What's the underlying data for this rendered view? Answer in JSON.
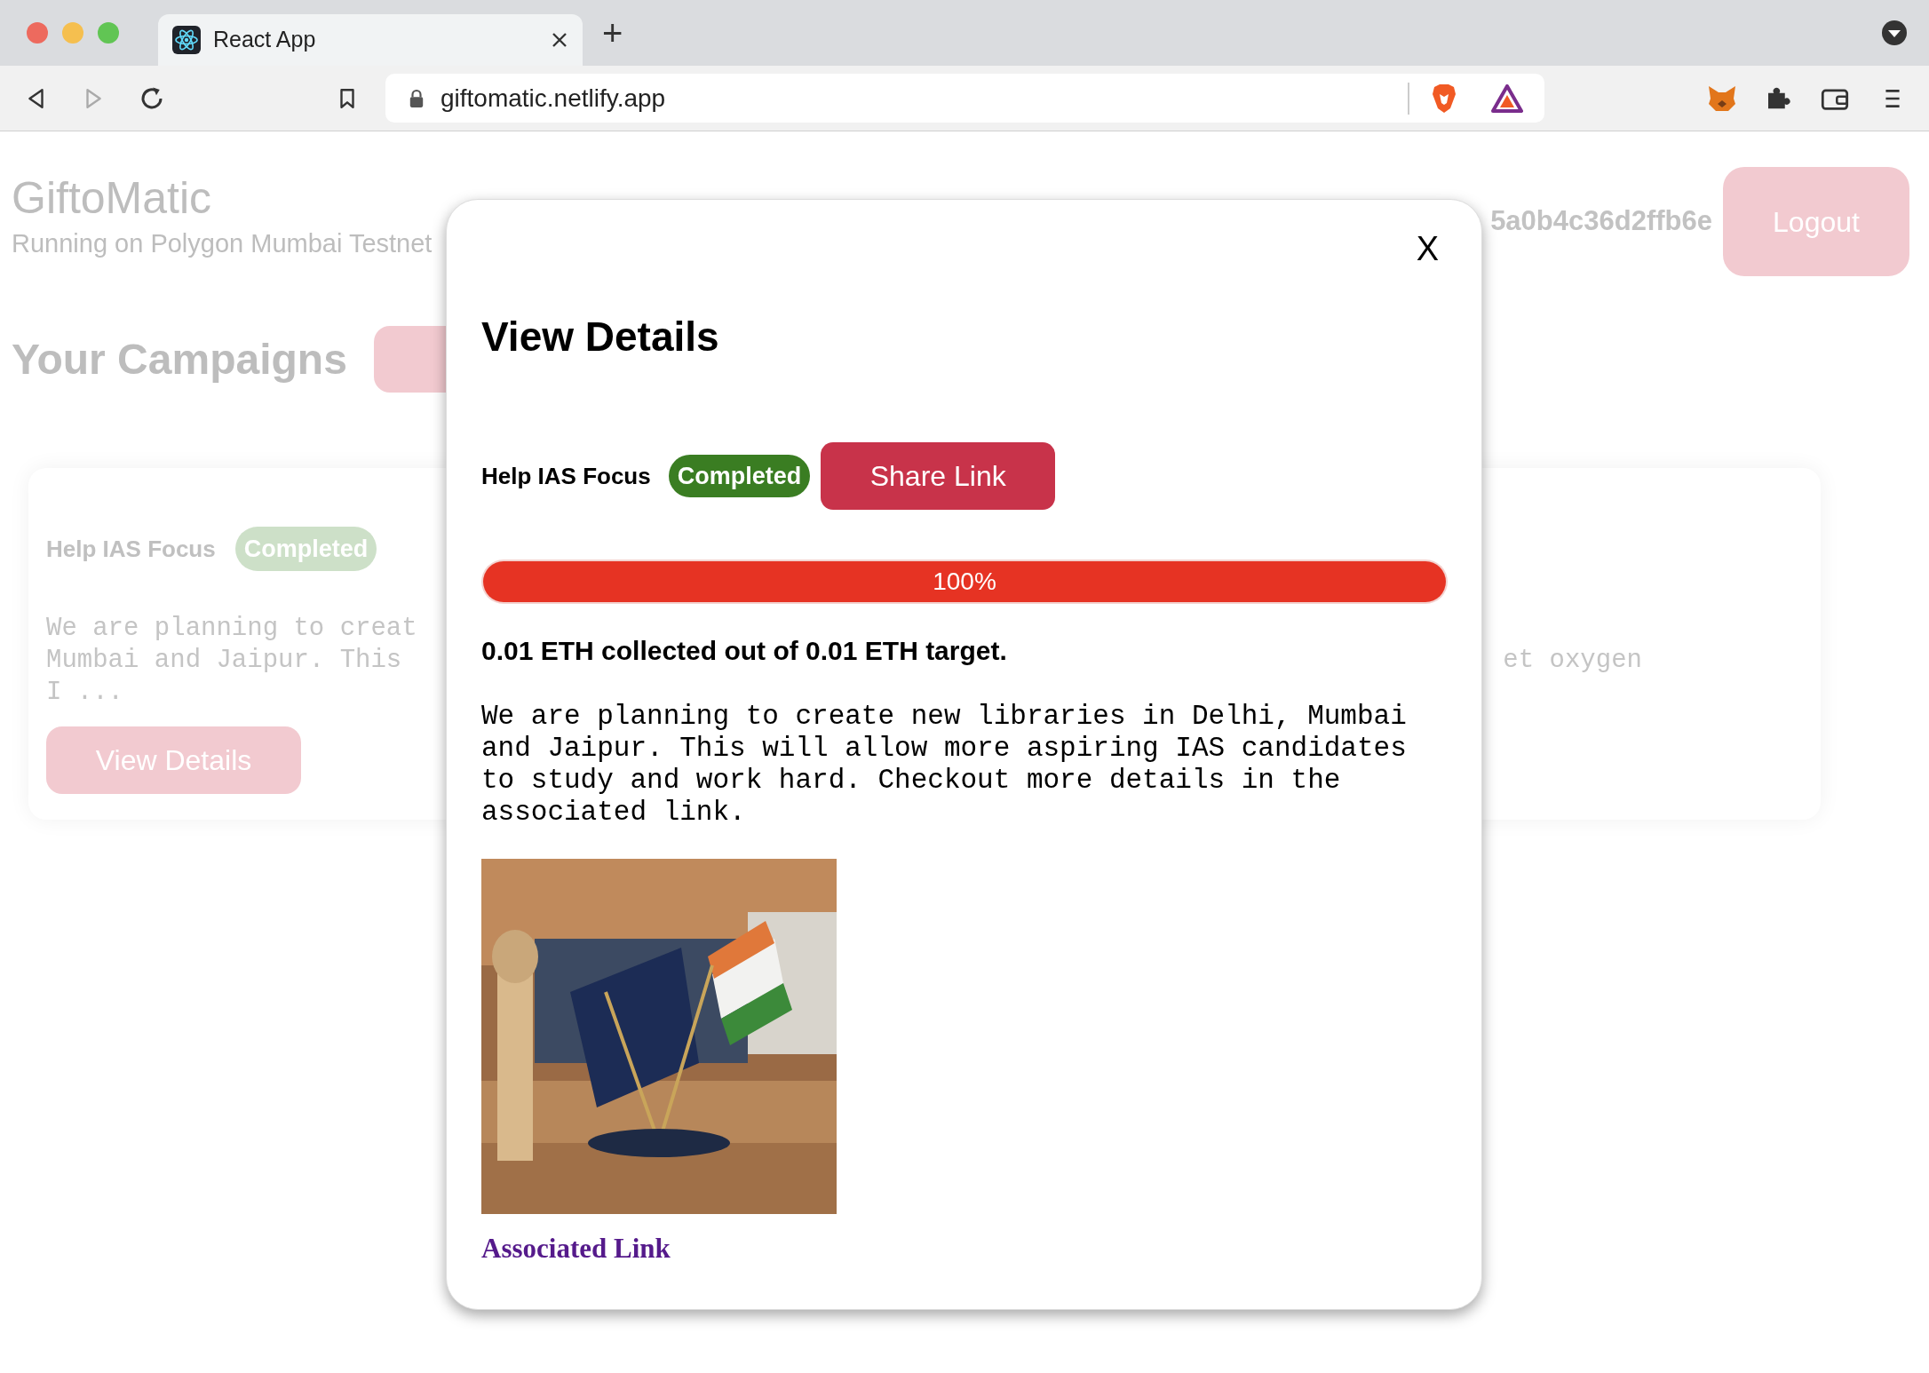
{
  "browser": {
    "tab": {
      "title": "React App"
    },
    "new_tab": "+",
    "address": "giftomatic.netlify.app"
  },
  "header": {
    "brand": "GiftoMatic",
    "subtitle": "Running on Polygon Mumbai Testnet",
    "account": "5a0b4c36d2ffb6e",
    "logout": "Logout"
  },
  "campaigns": {
    "heading": "Your Campaigns",
    "card": {
      "title": "Help IAS Focus",
      "status": "Completed",
      "description_lines": [
        "We are planning to creat",
        "Mumbai and Jaipur. This",
        "I ..."
      ],
      "description_right": "et oxygen",
      "button": "View Details"
    }
  },
  "modal": {
    "close": "X",
    "title": "View Details",
    "campaign": "Help IAS Focus",
    "status": "Completed",
    "share": "Share Link",
    "progress": {
      "level": 1,
      "label": "100%"
    },
    "summary": "0.01 ETH collected out of 0.01 ETH target.",
    "description": "We are planning to create new libraries in Delhi, Mumbai and Jaipur. This will allow more aspiring IAS candidates to study and work hard. Checkout more details in the associated link.",
    "link": "Associated Link"
  }
}
